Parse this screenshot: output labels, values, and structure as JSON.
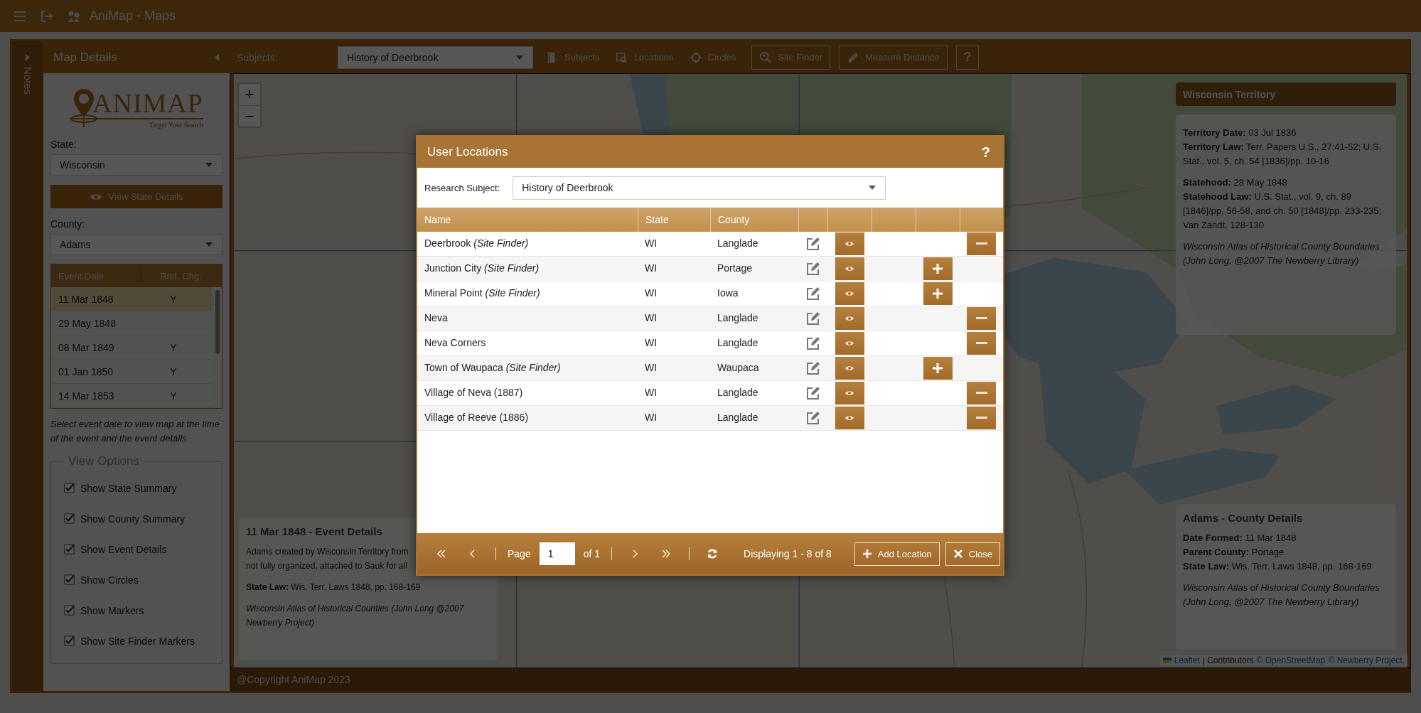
{
  "app_bar": {
    "title": "AniMap - Maps"
  },
  "notes_panel": {
    "label": "Notes"
  },
  "sidebar": {
    "title": "Map Details",
    "logo": {
      "wordmark": "ANIMAP",
      "tagline": "Target Your Search"
    },
    "state_field": {
      "label": "State:",
      "value": "Wisconsin"
    },
    "view_state_button": {
      "label": "View State Details"
    },
    "county_field": {
      "label": "County:",
      "value": "Adams"
    },
    "events": {
      "columns": [
        "Event Date",
        "Bnd. Chg."
      ],
      "rows": [
        {
          "date": "11 Mar 1848",
          "boundary_change": "Y",
          "selected": true
        },
        {
          "date": "29 May 1848",
          "selected": false
        },
        {
          "date": "08 Mar 1849",
          "boundary_change": "Y",
          "selected": false
        },
        {
          "date": "01 Jan 1850",
          "boundary_change": "Y",
          "selected": false
        },
        {
          "date": "14 Mar 1853",
          "boundary_change": "Y",
          "selected": false
        }
      ]
    },
    "hint": "Select event date to view map at the time of the event and the event details",
    "view_options": {
      "title": "View Options",
      "items": [
        {
          "label": "Show State Summary",
          "checked": true
        },
        {
          "label": "Show County Summary",
          "checked": true
        },
        {
          "label": "Show Event Details",
          "checked": true
        },
        {
          "label": "Show Circles",
          "checked": true
        },
        {
          "label": "Show Markers",
          "checked": true
        },
        {
          "label": "Show Site Finder Markers",
          "checked": true
        }
      ]
    }
  },
  "toolbar": {
    "subjects_label": "Subjects:",
    "subject_value": "History of Deerbrook",
    "buttons": [
      {
        "label": "Subjects",
        "kind": "plain"
      },
      {
        "label": "Locations",
        "kind": "plain"
      },
      {
        "label": "Circles",
        "kind": "plain"
      },
      {
        "label": "Site Finder",
        "kind": "outlined"
      },
      {
        "label": "Measure Distance",
        "kind": "outlined"
      },
      {
        "label": "?",
        "kind": "help"
      }
    ]
  },
  "map": {
    "kind": "picture",
    "zoom": [
      "+",
      "−"
    ],
    "state_panel": {
      "title": "Wisconsin Territory",
      "sections": [
        {
          "lines": [
            "**Territory Date:** 03 Jul 1836",
            "**Territory Law:** Terr. Papers U.S., 27:41-52; U.S. Stat., vol. 5, ch. 54 [1836]/pp. 10-16"
          ],
          "italic": false
        },
        {
          "lines": [
            "**Statehood:** 28 May 1848",
            "**Statehood Law:** U.S. Stat., vol. 9, ch. 89 [1846]/pp. 56-58, and ch. 50 [1848]/pp. 233-235; Van Zandt, 128-130"
          ],
          "italic": false
        },
        {
          "lines": [
            "Wisconsin Atlas of Historical County Boundaries (John Long, @2007 The Newberry Library)"
          ],
          "italic": true
        }
      ]
    },
    "county_panel": {
      "title": "Adams - County Details",
      "sections": [
        {
          "lines": [
            "**Date Formed:** 11 Mar 1848",
            "**Parent County:** Portage",
            "**State Law:** Wis. Terr. Laws 1848, pp. 168-169"
          ],
          "italic": false
        },
        {
          "lines": [
            "Wisconsin Atlas of Historical County Boundaries (John Long, @2007 The Newberry Library)"
          ],
          "italic": true
        }
      ]
    },
    "event_panel": {
      "title": "11 Mar 1848 - Event Details",
      "sections": [
        {
          "lines": [
            "Adams created by Wisconsin Territory from",
            "not fully organized, attached to Sauk for all"
          ],
          "italic": false
        },
        {
          "lines": [
            "**State Law:** Wis. Terr. Laws 1848, pp. 168-169"
          ],
          "italic": false
        },
        {
          "lines": [
            "Wisconsin Atlas of Historical Counties (John Long @2007 Newberry Project)"
          ],
          "italic": true
        }
      ]
    },
    "attribution": [
      {
        "text": "Leaflet",
        "link": true
      },
      {
        "text": "| Contributors",
        "link": false
      },
      {
        "text": "© OpenStreetMap",
        "link": true
      },
      {
        "text": "© Newberry Project.",
        "link": true
      }
    ]
  },
  "footer": {
    "text": "@Copyright AniMap 2023"
  },
  "dialog": {
    "title": "User Locations",
    "help": "?",
    "subject_label": "Research Subject:",
    "subject_value": "History of Deerbrook",
    "columns": [
      "Name",
      "State",
      "County"
    ],
    "rows": [
      {
        "name": "Deerbrook *(Site Finder)*",
        "state": "WI",
        "county": "Langlade",
        "kind": "remove"
      },
      {
        "name": "Junction City *(Site Finder)*",
        "state": "WI",
        "county": "Portage",
        "kind": "add"
      },
      {
        "name": "Mineral Point *(Site Finder)*",
        "state": "WI",
        "county": "Iowa",
        "kind": "add"
      },
      {
        "name": "Neva",
        "state": "WI",
        "county": "Langlade",
        "kind": "remove"
      },
      {
        "name": "Neva Corners",
        "state": "WI",
        "county": "Langlade",
        "kind": "remove"
      },
      {
        "name": "Town of Waupaca *(Site Finder)*",
        "state": "WI",
        "county": "Waupaca",
        "kind": "add"
      },
      {
        "name": "Village of Neva (1887)",
        "state": "WI",
        "county": "Langlade",
        "kind": "remove"
      },
      {
        "name": "Village of Reeve (1886)",
        "state": "WI",
        "county": "Langlade",
        "kind": "remove"
      }
    ],
    "pager": {
      "page_label": "Page",
      "page": "1",
      "of": "of 1",
      "display": "Displaying 1 - 8 of 8"
    },
    "buttons": [
      {
        "label": "Add Location",
        "kind": "add"
      },
      {
        "label": "Close",
        "kind": "close"
      }
    ]
  }
}
